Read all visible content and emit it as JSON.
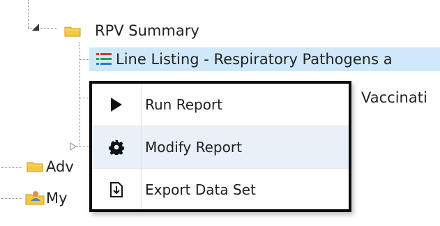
{
  "tree": {
    "rpv_folder_label": "RPV Summary",
    "selected_item_label": "Line Listing - Respiratory Pathogens a",
    "partial_item_label": "Vaccinati",
    "folder_adv_label": "Adv",
    "folder_my_label": "My"
  },
  "context_menu": {
    "items": [
      {
        "label": "Run Report",
        "icon": "play-icon"
      },
      {
        "label": "Modify Report",
        "icon": "gear-icon"
      },
      {
        "label": "Export Data Set",
        "icon": "export-icon"
      }
    ],
    "hover_index": 1
  },
  "colors": {
    "selection": "#cfe9fb",
    "menu_hover": "#e8f0f8",
    "folder": "#f5c842",
    "list_icon_red": "#d63a3a",
    "list_icon_green": "#2e9f4a"
  }
}
